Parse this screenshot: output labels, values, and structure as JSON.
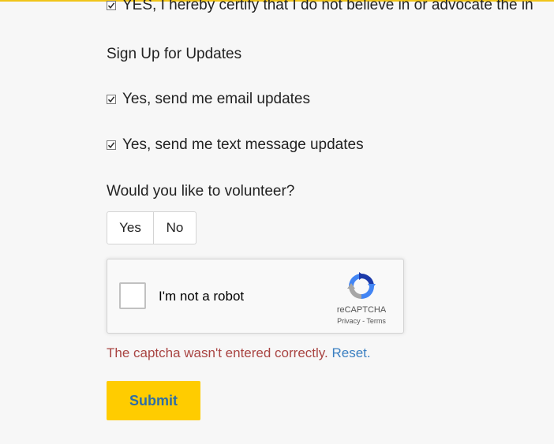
{
  "certify": {
    "label": "YES, I hereby certify that I do not believe in or advocate the in",
    "checked": true
  },
  "updates_section": {
    "heading": "Sign Up for Updates",
    "email_label": "Yes, send me email updates",
    "text_label": "Yes, send me text message updates"
  },
  "volunteer": {
    "question": "Would you like to volunteer?",
    "yes_label": "Yes",
    "no_label": "No"
  },
  "recaptcha": {
    "label": "I'm not a robot",
    "brand": "reCAPTCHA",
    "privacy": "Privacy",
    "separator": " - ",
    "terms": "Terms"
  },
  "error": {
    "message": "The captcha wasn't entered correctly.",
    "reset": "Reset",
    "period": "."
  },
  "submit_label": "Submit",
  "colors": {
    "accent_yellow": "#ffcc00",
    "top_border": "#f0c419",
    "error_red": "#a94442",
    "link_blue": "#3a7fc1",
    "submit_text": "#2f6ea5"
  },
  "icons": [
    "checkbox-checked-icon",
    "recaptcha-logo-icon"
  ]
}
